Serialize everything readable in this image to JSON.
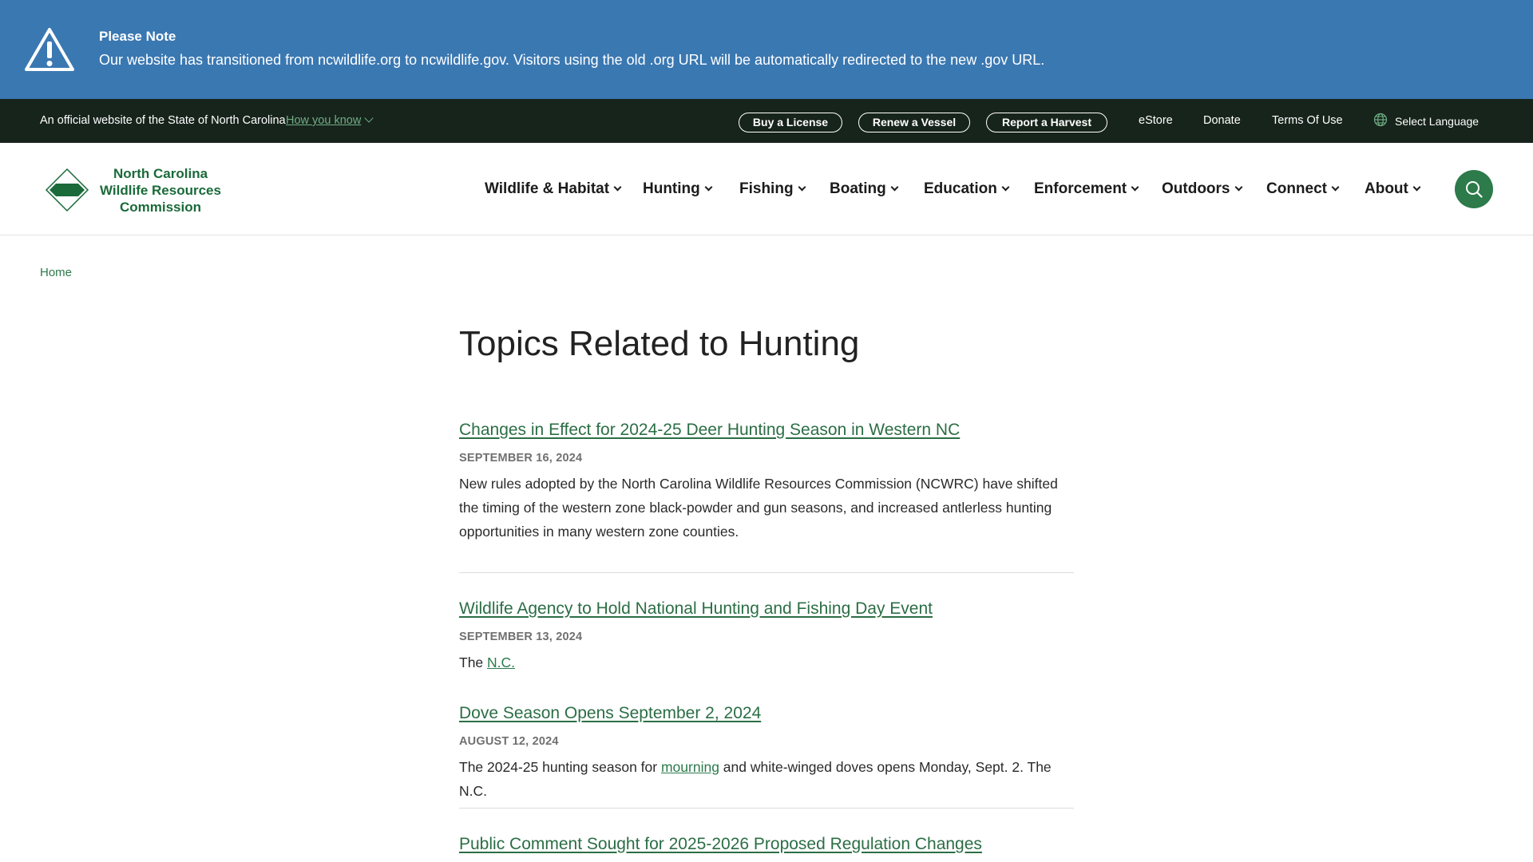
{
  "alert": {
    "title": "Please Note",
    "text": "Our website has transitioned from ncwildlife.org to ncwildlife.gov. Visitors using the old .org URL will be automatically redirected to the new .gov URL.",
    "icon": "warning-triangle-icon"
  },
  "official_bar": {
    "text": "An official website of the State of North Carolina",
    "how_you_know": "How you know",
    "buttons": [
      "Buy a License",
      "Renew a Vessel",
      "Report a Harvest"
    ],
    "links": [
      "eStore",
      "Donate",
      "Terms Of Use"
    ],
    "language": "Select Language"
  },
  "header": {
    "logo_lines": [
      "North Carolina",
      "Wildlife Resources",
      "Commission"
    ],
    "nav": [
      "Wildlife & Habitat",
      "Hunting",
      "Fishing",
      "Boating",
      "Education",
      "Enforcement",
      "Outdoors",
      "Connect",
      "About"
    ]
  },
  "breadcrumb": "Home",
  "page_title": "Topics Related to Hunting",
  "articles": [
    {
      "title": "Changes in Effect for 2024-25 Deer Hunting Season in Western NC",
      "date": "SEPTEMBER 16, 2024",
      "body": "New rules adopted by the North Carolina Wildlife Resources Commission (NCWRC) have shifted the timing of the western zone black-powder and gun seasons, and increased antlerless hunting opportunities in many western zone counties."
    },
    {
      "title": "Wildlife Agency to Hold National Hunting and Fishing Day Event",
      "date": "SEPTEMBER 13, 2024",
      "body_prefix": "The ",
      "body_link": "N.C."
    },
    {
      "title": "Dove Season Opens September 2, 2024",
      "date": "AUGUST 12, 2024",
      "body_prefix": "The 2024-25 hunting season for ",
      "body_link": "mourning",
      "body_suffix": " and white-winged doves opens Monday, Sept. 2. The N.C."
    },
    {
      "title": "Public Comment Sought for 2025-2026 Proposed Regulation Changes"
    }
  ],
  "colors": {
    "alert_bg": "#3a78b2",
    "official_bg": "#17241c",
    "brand_green": "#2d7a4a"
  }
}
